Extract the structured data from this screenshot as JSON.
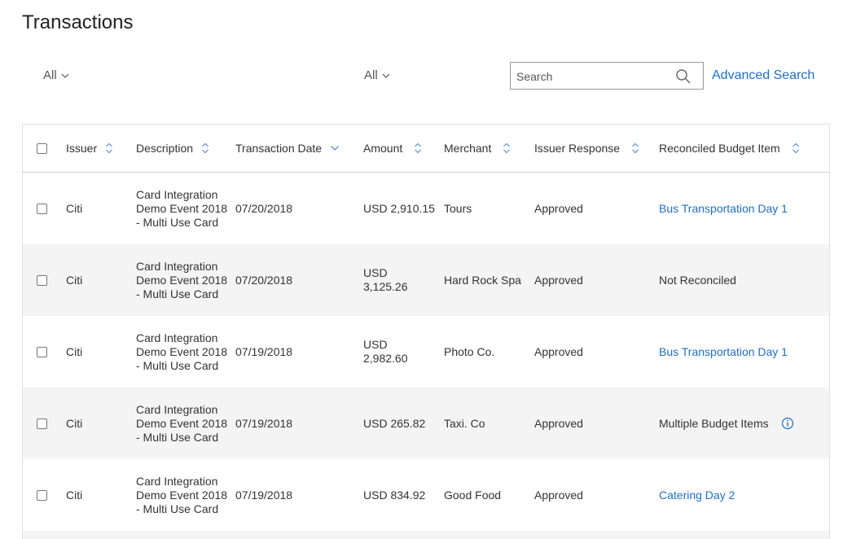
{
  "page": {
    "title": "Transactions"
  },
  "filters": {
    "left_label": "All",
    "middle_label": "All"
  },
  "search": {
    "placeholder": "Search",
    "value": "",
    "advanced_label": "Advanced Search"
  },
  "table": {
    "headers": {
      "issuer": "Issuer",
      "description": "Description",
      "date": "Transaction Date",
      "amount": "Amount",
      "merchant": "Merchant",
      "response": "Issuer Response",
      "reconciled": "Reconciled Budget Item"
    },
    "rows": [
      {
        "issuer": "Citi",
        "description": "Card Integration Demo Event 2018 - Multi Use Card",
        "date": "07/20/2018",
        "amount": "USD 2,910.15",
        "merchant": "Tours",
        "response": "Approved",
        "reconciled": "Bus Transportation Day 1",
        "reconciled_link": true
      },
      {
        "issuer": "Citi",
        "description": "Card Integration Demo Event 2018 - Multi Use Card",
        "date": "07/20/2018",
        "amount": "USD 3,125.26",
        "merchant": "Hard Rock Spa",
        "response": "Approved",
        "reconciled": "Not Reconciled",
        "reconciled_link": false
      },
      {
        "issuer": "Citi",
        "description": "Card Integration Demo Event 2018 - Multi Use Card",
        "date": "07/19/2018",
        "amount": "USD 2,982.60",
        "merchant": "Photo Co.",
        "response": "Approved",
        "reconciled": "Bus Transportation Day 1",
        "reconciled_link": true
      },
      {
        "issuer": "Citi",
        "description": "Card Integration Demo Event 2018 - Multi Use Card",
        "date": "07/19/2018",
        "amount": "USD 265.82",
        "merchant": "Taxi. Co",
        "response": "Approved",
        "reconciled": "Multiple Budget Items",
        "reconciled_link": false,
        "info_icon": "info-icon"
      },
      {
        "issuer": "Citi",
        "description": "Card Integration Demo Event 2018 - Multi Use Card",
        "date": "07/19/2018",
        "amount": "USD 834.92",
        "merchant": "Good Food",
        "response": "Approved",
        "reconciled": "Catering Day 2",
        "reconciled_link": true
      }
    ]
  },
  "colors": {
    "link": "#1f6fc5",
    "alt_row": "#f4f4f4",
    "sort_icon": "#5b8fd6"
  },
  "icons": {
    "search": "search-icon",
    "filter_dropdown": "chevron-down-icon",
    "sort": "sort-icon",
    "sort_desc": "chevron-down-icon",
    "info": "info-icon"
  }
}
